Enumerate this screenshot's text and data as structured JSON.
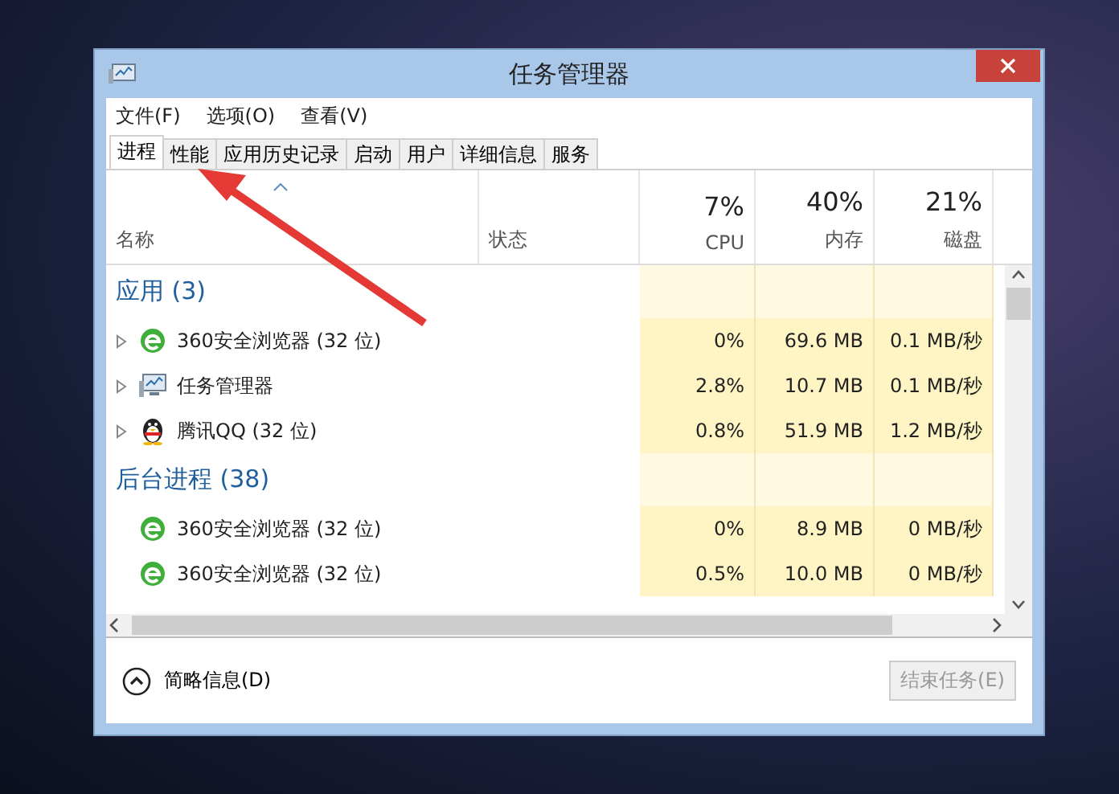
{
  "window": {
    "title": "任务管理器"
  },
  "menu": [
    "文件(F)",
    "选项(O)",
    "查看(V)"
  ],
  "tabs": [
    {
      "label": "进程",
      "selected": true
    },
    {
      "label": "性能",
      "selected": false
    },
    {
      "label": "应用历史记录",
      "selected": false
    },
    {
      "label": "启动",
      "selected": false
    },
    {
      "label": "用户",
      "selected": false
    },
    {
      "label": "详细信息",
      "selected": false
    },
    {
      "label": "服务",
      "selected": false
    }
  ],
  "columns": [
    {
      "label": "名称"
    },
    {
      "label": "状态"
    },
    {
      "usage": "7%",
      "label": "CPU"
    },
    {
      "usage": "40%",
      "label": "内存"
    },
    {
      "usage": "21%",
      "label": "磁盘"
    }
  ],
  "groups": [
    {
      "title": "应用 (3)",
      "rows": [
        {
          "kind": "browser",
          "expandable": true,
          "name": "360安全浏览器 (32 位)",
          "cpu": "0%",
          "memory": "69.6 MB",
          "disk": "0.1 MB/秒"
        },
        {
          "kind": "monitor",
          "expandable": true,
          "name": "任务管理器",
          "cpu": "2.8%",
          "memory": "10.7 MB",
          "disk": "0.1 MB/秒"
        },
        {
          "kind": "penguin",
          "expandable": true,
          "name": "腾讯QQ (32 位)",
          "cpu": "0.8%",
          "memory": "51.9 MB",
          "disk": "1.2 MB/秒"
        }
      ]
    },
    {
      "title": "后台进程 (38)",
      "rows": [
        {
          "kind": "browser",
          "expandable": false,
          "name": "360安全浏览器 (32 位)",
          "cpu": "0%",
          "memory": "8.9 MB",
          "disk": "0 MB/秒"
        },
        {
          "kind": "browser",
          "expandable": false,
          "name": "360安全浏览器 (32 位)",
          "cpu": "0.5%",
          "memory": "10.0 MB",
          "disk": "0 MB/秒"
        }
      ]
    }
  ],
  "footer": {
    "details_toggle": "简略信息(D)",
    "end_task": {
      "label": "结束任务(E)",
      "disabled": true
    }
  }
}
